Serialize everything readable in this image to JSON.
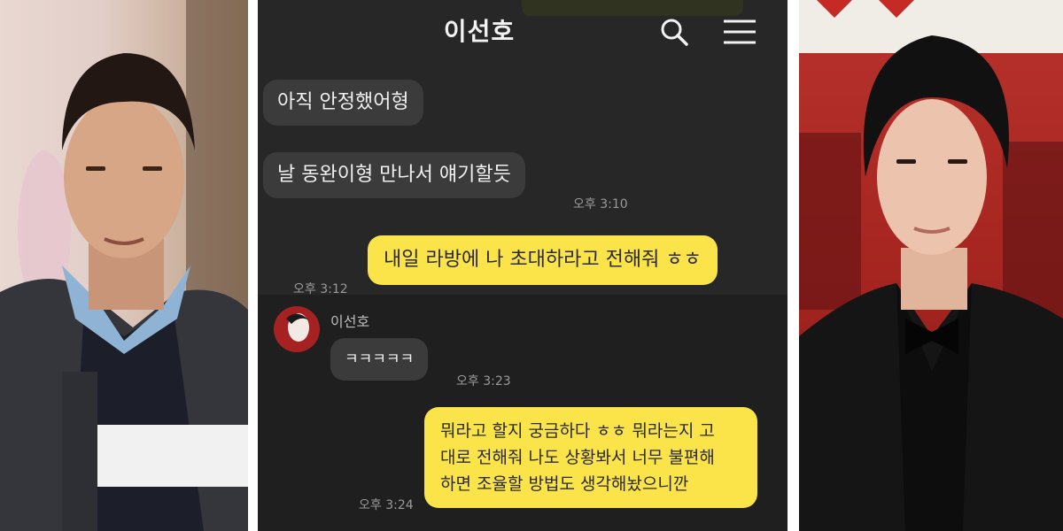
{
  "chat": {
    "title": "이선호",
    "messages": [
      {
        "text": "아직 안정했어형"
      },
      {
        "text": "날 동완이형 만나서 얘기할듯",
        "time": "오후 3:10"
      },
      {
        "text": "내일 라방에 나 초대하라고 전해줘 ㅎㅎ",
        "time": "오후 3:12"
      },
      {
        "sender": "이선호",
        "text": "ㅋㅋㅋㅋㅋ",
        "time": "오후 3:23"
      },
      {
        "text": "뭐라고 할지 궁금하다 ㅎㅎ 뭐라는지 고\n대로 전해줘 나도 상황봐서 너무 불편해\n하면 조율할 방법도 생각해놨으니깐",
        "time": "오후 3:24"
      }
    ]
  },
  "icons": {
    "search": "search-icon",
    "menu": "menu-icon",
    "avatar": "avatar"
  },
  "colors": {
    "chat_bg": "#272727",
    "incoming_bubble": "#3b3b3b",
    "outgoing_bubble": "#fbe34a"
  }
}
